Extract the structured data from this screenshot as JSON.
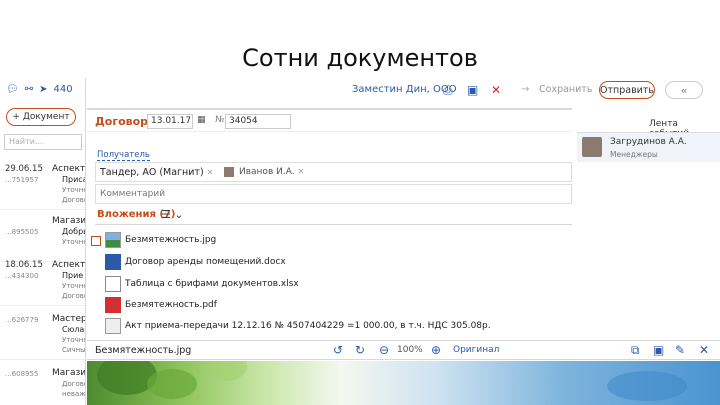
{
  "slide": {
    "title": "Сотни документов"
  },
  "left_panel": {
    "icons": [
      "comment-icon",
      "link-icon",
      "send-icon"
    ],
    "counter": "440",
    "add_button": "+ Документ",
    "search_placeholder": "Найти...",
    "items": [
      {
        "date": "29.06.15",
        "num": "...751957",
        "title": "Аспект...",
        "line2": "Приса",
        "line3": "Уточне",
        "line4": "Договор"
      },
      {
        "date": "",
        "num": "...895505",
        "title": "Магазин",
        "line2": "Добрь",
        "line3": "Уточне",
        "line4": ""
      },
      {
        "date": "18.06.15",
        "num": "...434300",
        "title": "Аспект...",
        "line2": "Прие",
        "line3": "Уточне",
        "line4": "Договор"
      },
      {
        "date": "",
        "num": "...626779",
        "title": "Мастер",
        "line2": "Сюла",
        "line3": "Уточне",
        "line4": "Сичны"
      },
      {
        "date": "",
        "num": "...608955",
        "title": "Магазин",
        "line2": "",
        "line3": "Договор",
        "line4": "неважны"
      }
    ]
  },
  "toolbar": {
    "org": "Заместин Дин, ООО",
    "save": "Сохранить",
    "send": "Отправить",
    "back": "«"
  },
  "document": {
    "type": "Договор",
    "date": "13.01.17",
    "num_sign": "№",
    "number": "34054",
    "recipient_label": "Получатель",
    "recipient_org": "Тандер, АО (Магнит)",
    "recipient_person": "Иванов И.А.",
    "comment_placeholder": "Комментарий",
    "attachments_label": "Вложения (7)",
    "attachments": [
      {
        "icon": "image-icon",
        "name": "Безмятежность.jpg"
      },
      {
        "icon": "word-doc-icon",
        "name": "Договор аренды помещений.docx"
      },
      {
        "icon": "excel-icon",
        "name": "Таблица с брифами документов.xlsx"
      },
      {
        "icon": "pdf-icon",
        "name": "Безмятежность.pdf"
      },
      {
        "icon": "scan-icon",
        "name": "Акт приема-передачи 12.12.16 № 4507404229 =1 000.00, в т.ч. НДС 305.08р."
      }
    ]
  },
  "feed": {
    "title": "Лента событий",
    "name": "Загрудинов А.А.",
    "role": "Менеджеры"
  },
  "viewer": {
    "file": "Безмятежность.jpg",
    "zoom": "100%",
    "original": "Оригинал"
  }
}
